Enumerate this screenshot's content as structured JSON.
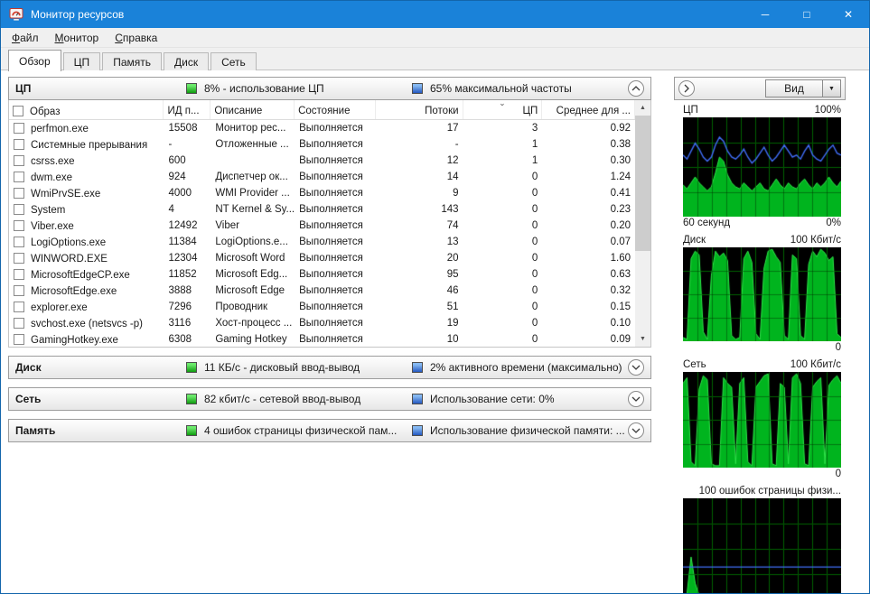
{
  "colors": {
    "titlebar": "#1a82d9",
    "green_indicator": "#0f9b0f",
    "blue_indicator": "#2458c0",
    "chart_green": "#00b41e",
    "chart_blue": "#3f6cf5"
  },
  "window": {
    "title": "Монитор ресурсов",
    "minimize_glyph": "─",
    "maximize_glyph": "□",
    "close_glyph": "✕"
  },
  "menu_items": [
    "Файл",
    "Монитор",
    "Справка"
  ],
  "tabs": [
    "Обзор",
    "ЦП",
    "Память",
    "Диск",
    "Сеть"
  ],
  "active_tab": "Обзор",
  "sections": {
    "cpu": {
      "title": "ЦП",
      "green_label": "8% - использование ЦП",
      "blue_label": "65% максимальной частоты"
    },
    "disk": {
      "title": "Диск",
      "green_label": "11 КБ/с - дисковый ввод-вывод",
      "blue_label": "2% активного времени (максимально)"
    },
    "network": {
      "title": "Сеть",
      "green_label": "82 кбит/с - сетевой ввод-вывод",
      "blue_label": "Использование сети: 0%"
    },
    "memory": {
      "title": "Память",
      "green_label": "4 ошибок страницы физической пам...",
      "blue_label": "Использование физической памяти: ..."
    }
  },
  "process_table": {
    "columns": [
      {
        "label": "Образ",
        "align": "left"
      },
      {
        "label": "ИД п...",
        "align": "left"
      },
      {
        "label": "Описание",
        "align": "left"
      },
      {
        "label": "Состояние",
        "align": "left"
      },
      {
        "label": "Потоки",
        "align": "right"
      },
      {
        "label": "ЦП",
        "align": "right",
        "sorted": true
      },
      {
        "label": "Среднее для ...",
        "align": "right"
      }
    ],
    "rows": [
      {
        "image": "perfmon.exe",
        "pid": "15508",
        "description": "Монитор рес...",
        "status": "Выполняется",
        "threads": "17",
        "cpu": "3",
        "avg": "0.92"
      },
      {
        "image": "Системные прерывания",
        "pid": "-",
        "description": "Отложенные ...",
        "status": "Выполняется",
        "threads": "-",
        "cpu": "1",
        "avg": "0.38"
      },
      {
        "image": "csrss.exe",
        "pid": "600",
        "description": "",
        "status": "Выполняется",
        "threads": "12",
        "cpu": "1",
        "avg": "0.30"
      },
      {
        "image": "dwm.exe",
        "pid": "924",
        "description": "Диспетчер ок...",
        "status": "Выполняется",
        "threads": "14",
        "cpu": "0",
        "avg": "1.24"
      },
      {
        "image": "WmiPrvSE.exe",
        "pid": "4000",
        "description": "WMI Provider ...",
        "status": "Выполняется",
        "threads": "9",
        "cpu": "0",
        "avg": "0.41"
      },
      {
        "image": "System",
        "pid": "4",
        "description": "NT Kernel & Sy...",
        "status": "Выполняется",
        "threads": "143",
        "cpu": "0",
        "avg": "0.23"
      },
      {
        "image": "Viber.exe",
        "pid": "12492",
        "description": "Viber",
        "status": "Выполняется",
        "threads": "74",
        "cpu": "0",
        "avg": "0.20"
      },
      {
        "image": "LogiOptions.exe",
        "pid": "11384",
        "description": "LogiOptions.e...",
        "status": "Выполняется",
        "threads": "13",
        "cpu": "0",
        "avg": "0.07"
      },
      {
        "image": "WINWORD.EXE",
        "pid": "12304",
        "description": "Microsoft Word",
        "status": "Выполняется",
        "threads": "20",
        "cpu": "0",
        "avg": "1.60"
      },
      {
        "image": "MicrosoftEdgeCP.exe",
        "pid": "11852",
        "description": "Microsoft Edg...",
        "status": "Выполняется",
        "threads": "95",
        "cpu": "0",
        "avg": "0.63"
      },
      {
        "image": "MicrosoftEdge.exe",
        "pid": "3888",
        "description": "Microsoft Edge",
        "status": "Выполняется",
        "threads": "46",
        "cpu": "0",
        "avg": "0.32"
      },
      {
        "image": "explorer.exe",
        "pid": "7296",
        "description": "Проводник",
        "status": "Выполняется",
        "threads": "51",
        "cpu": "0",
        "avg": "0.15"
      },
      {
        "image": "svchost.exe (netsvcs -p)",
        "pid": "3116",
        "description": "Хост-процесс ...",
        "status": "Выполняется",
        "threads": "19",
        "cpu": "0",
        "avg": "0.10"
      },
      {
        "image": "GamingHotkey.exe",
        "pid": "6308",
        "description": "Gaming Hotkey",
        "status": "Выполняется",
        "threads": "10",
        "cpu": "0",
        "avg": "0.09"
      }
    ]
  },
  "side_panel": {
    "view_button_label": "Вид",
    "charts": [
      {
        "title": "ЦП",
        "scale_label": "100%",
        "footer_left": "60 секунд",
        "footer_right": "0%"
      },
      {
        "title": "Диск",
        "scale_label": "100 Кбит/с",
        "footer_left": "",
        "footer_right": "0"
      },
      {
        "title": "Сеть",
        "scale_label": "100 Кбит/с",
        "footer_left": "",
        "footer_right": "0"
      },
      {
        "title": "",
        "scale_label": "100 ошибок страницы физи...",
        "footer_left": "",
        "footer_right": ""
      }
    ]
  },
  "chart_data": [
    {
      "type": "area",
      "title": "ЦП",
      "ylim": [
        0,
        100
      ],
      "x_window": "60 секунд",
      "series": [
        {
          "name": "Использование ЦП",
          "color": "green",
          "values": [
            32,
            28,
            34,
            40,
            34,
            30,
            26,
            30,
            44,
            60,
            56,
            42,
            34,
            30,
            28,
            34,
            30,
            26,
            30,
            34,
            28,
            26,
            32,
            38,
            32,
            28,
            34,
            30,
            28,
            34,
            38,
            32,
            28,
            34,
            30,
            34,
            40,
            34,
            30,
            36
          ]
        },
        {
          "name": "Максимальная частота",
          "color": "blue",
          "values": [
            62,
            58,
            66,
            74,
            68,
            60,
            56,
            60,
            72,
            80,
            76,
            66,
            60,
            58,
            62,
            68,
            60,
            54,
            58,
            64,
            70,
            62,
            56,
            60,
            66,
            72,
            66,
            60,
            62,
            58,
            66,
            72,
            62,
            58,
            56,
            62,
            68,
            72,
            64,
            62
          ]
        }
      ]
    },
    {
      "type": "area",
      "title": "Диск",
      "ylim": [
        0,
        100
      ],
      "series": [
        {
          "name": "Дисковый ввод-вывод",
          "color": "green",
          "values": [
            4,
            2,
            88,
            96,
            92,
            10,
            2,
            70,
            96,
            90,
            94,
            86,
            6,
            2,
            4,
            88,
            96,
            84,
            8,
            2,
            78,
            96,
            98,
            90,
            84,
            6,
            2,
            92,
            88,
            6,
            2,
            82,
            96,
            90,
            98,
            94,
            86,
            90,
            8,
            4
          ]
        }
      ]
    },
    {
      "type": "area",
      "title": "Сеть",
      "ylim": [
        0,
        100
      ],
      "series": [
        {
          "name": "Сетевой ввод-вывод",
          "color": "green",
          "values": [
            88,
            94,
            6,
            2,
            82,
            96,
            92,
            4,
            2,
            2,
            94,
            88,
            84,
            4,
            88,
            94,
            6,
            2,
            84,
            90,
            96,
            98,
            4,
            2,
            88,
            84,
            4,
            94,
            98,
            88,
            4,
            2,
            84,
            90,
            94,
            4,
            86,
            92,
            96,
            88
          ]
        }
      ]
    },
    {
      "type": "area",
      "title": "Память",
      "ylim": [
        0,
        100
      ],
      "series": [
        {
          "name": "Ошибки страницы",
          "color": "green",
          "values": [
            2,
            6,
            42,
            16,
            4,
            0,
            0,
            0,
            2,
            0,
            0,
            0,
            0,
            0,
            0,
            4,
            0,
            0,
            0,
            0,
            0,
            0,
            0,
            0,
            0,
            0,
            0,
            0,
            0,
            0,
            0,
            0,
            2,
            0,
            0,
            0,
            0,
            0,
            0,
            0
          ]
        },
        {
          "name": "Использование физической памяти",
          "color": "blue",
          "values": [
            32,
            32,
            32,
            32,
            32,
            32,
            32,
            32,
            32,
            32,
            32,
            32,
            32,
            32,
            32,
            32,
            32,
            32,
            32,
            32,
            32,
            32,
            32,
            32,
            32,
            32,
            32,
            32,
            32,
            32,
            32,
            32,
            32,
            32,
            32,
            32,
            32,
            32,
            32,
            32
          ]
        }
      ]
    }
  ]
}
